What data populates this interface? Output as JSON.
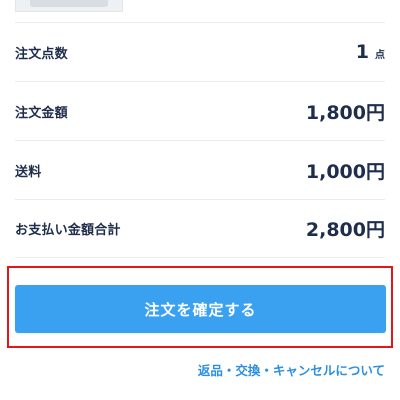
{
  "summary": {
    "rows": [
      {
        "label": "注文点数",
        "value": "1",
        "unit": "点"
      },
      {
        "label": "注文金額",
        "value": "1,800円"
      },
      {
        "label": "送料",
        "value": "1,000円"
      },
      {
        "label": "お支払い金額合計",
        "value": "2,800円"
      }
    ]
  },
  "confirm_button": {
    "label": "注文を確定する"
  },
  "returns_link": {
    "label": "返品・交換・キャンセルについて"
  },
  "colors": {
    "button": "#3aa0f0",
    "highlight": "#e01818",
    "link": "#2d8fe0",
    "text": "#1f2d4d"
  }
}
